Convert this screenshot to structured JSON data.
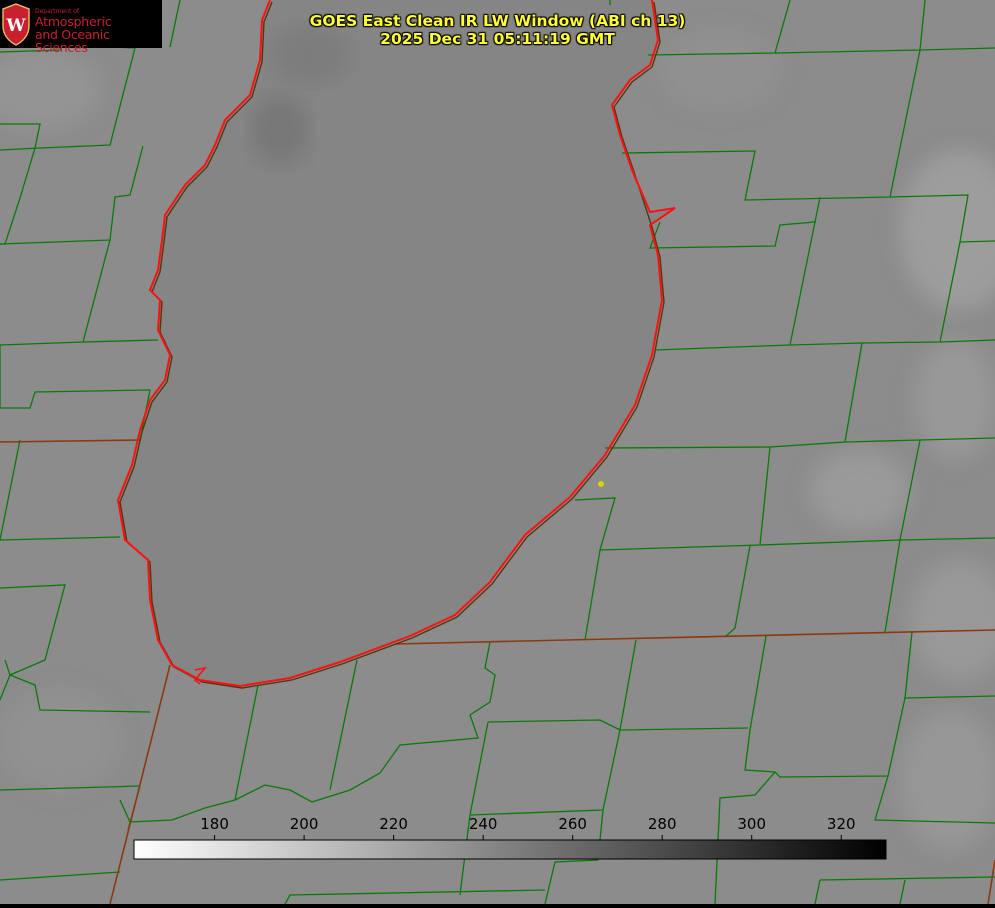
{
  "header": {
    "title": "GOES East Clean IR LW Window (ABI ch 13)",
    "timestamp": "2025 Dec 31 05:11:19 GMT"
  },
  "logo": {
    "department": "Department of",
    "line1": "Atmospheric",
    "line2": "and Oceanic Sciences",
    "seal_letter": "W"
  },
  "colorbar": {
    "ticks": [
      "180",
      "200",
      "220",
      "240",
      "260",
      "280",
      "300",
      "320"
    ],
    "range": [
      162,
      330
    ],
    "colormap": "white-to-black"
  },
  "colors": {
    "background_gray": "#8a8a8a",
    "lake_gray": "#848484",
    "county_lines": "#0a7a0a",
    "state_lines": "#8a3a10",
    "shoreline": "#ff1010",
    "station_marker": "#e0d000",
    "title_text": "#ffff33",
    "logo_red": "#c8202e"
  }
}
